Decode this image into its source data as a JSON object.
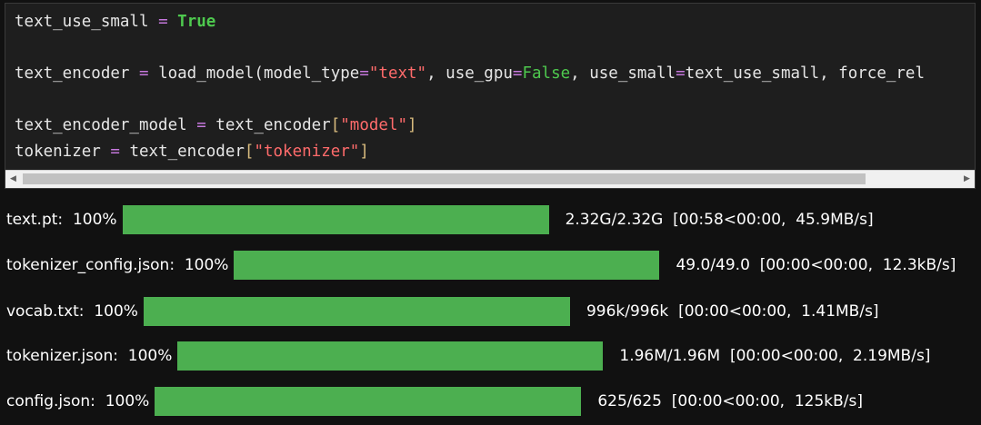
{
  "code": {
    "lines": [
      [
        {
          "t": "text_use_small",
          "c": ""
        },
        {
          "t": " ",
          "c": ""
        },
        {
          "t": "=",
          "c": "op"
        },
        {
          "t": " ",
          "c": ""
        },
        {
          "t": "True",
          "c": "kw"
        }
      ],
      [],
      [
        {
          "t": "text_encoder",
          "c": ""
        },
        {
          "t": " ",
          "c": ""
        },
        {
          "t": "=",
          "c": "op"
        },
        {
          "t": " load_model(model_type",
          "c": ""
        },
        {
          "t": "=",
          "c": "op"
        },
        {
          "t": "\"text\"",
          "c": "str"
        },
        {
          "t": ", use_gpu",
          "c": ""
        },
        {
          "t": "=",
          "c": "op"
        },
        {
          "t": "False",
          "c": "fl"
        },
        {
          "t": ", use_small",
          "c": ""
        },
        {
          "t": "=",
          "c": "op"
        },
        {
          "t": "text_use_small, force_rel",
          "c": ""
        }
      ],
      [],
      [
        {
          "t": "text_encoder_model",
          "c": ""
        },
        {
          "t": " ",
          "c": ""
        },
        {
          "t": "=",
          "c": "op"
        },
        {
          "t": " text_encoder",
          "c": ""
        },
        {
          "t": "[",
          "c": "br"
        },
        {
          "t": "\"model\"",
          "c": "str"
        },
        {
          "t": "]",
          "c": "br"
        }
      ],
      [
        {
          "t": "tokenizer",
          "c": ""
        },
        {
          "t": " ",
          "c": ""
        },
        {
          "t": "=",
          "c": "op"
        },
        {
          "t": " text_encoder",
          "c": ""
        },
        {
          "t": "[",
          "c": "br"
        },
        {
          "t": "\"tokenizer\"",
          "c": "str"
        },
        {
          "t": "]",
          "c": "br"
        }
      ]
    ]
  },
  "scrollbar": {
    "left_arrow": "◀",
    "right_arrow": "▶"
  },
  "colors": {
    "progress_fill": "#4caf50",
    "background": "#111111"
  },
  "downloads": [
    {
      "file": "text.pt:",
      "percent_text": "100%",
      "progress": 1.0,
      "stats": "2.32G/2.32G  [00:58<00:00,  45.9MB/s]"
    },
    {
      "file": "tokenizer_config.json:",
      "percent_text": "100%",
      "progress": 1.0,
      "stats": "49.0/49.0  [00:00<00:00,  12.3kB/s]"
    },
    {
      "file": "vocab.txt:",
      "percent_text": "100%",
      "progress": 1.0,
      "stats": "996k/996k  [00:00<00:00,  1.41MB/s]"
    },
    {
      "file": "tokenizer.json:",
      "percent_text": "100%",
      "progress": 1.0,
      "stats": "1.96M/1.96M  [00:00<00:00,  2.19MB/s]"
    },
    {
      "file": "config.json:",
      "percent_text": "100%",
      "progress": 1.0,
      "stats": "625/625  [00:00<00:00,  125kB/s]"
    }
  ]
}
